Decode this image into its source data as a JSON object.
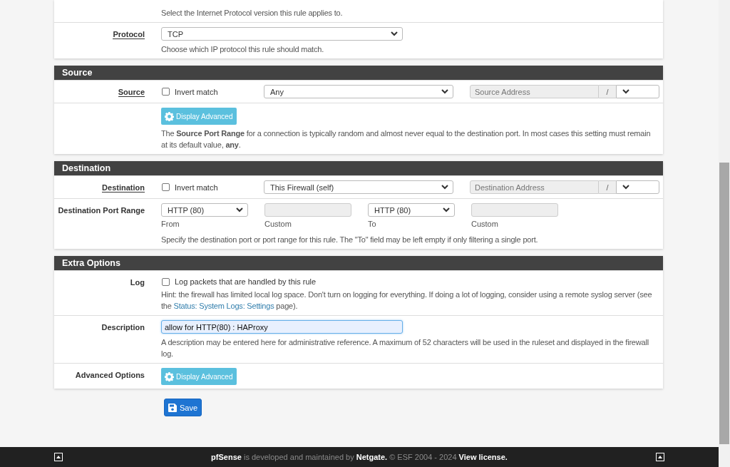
{
  "panels": [
    {
      "rows": [
        {
          "kind": "hint",
          "hint": "Select the Internet Protocol version this rule applies to."
        },
        {
          "kind": "select",
          "label": "Protocol",
          "has_help": true,
          "value": "TCP",
          "hint": "Choose which IP protocol this rule should match."
        }
      ]
    },
    {
      "title": "Source",
      "rows": [
        {
          "kind": "address",
          "label": "Source",
          "has_help": true,
          "invert_label": "Invert match",
          "invert_checked": false,
          "type_value": "Any",
          "address_placeholder": "Source Address",
          "slash": "/"
        },
        {
          "kind": "advanced",
          "button": "Display Advanced",
          "hint": "The **Source Port Range** for a connection is typically random and almost never equal to the destination port. In most cases this setting must remain at its default value, **any**."
        }
      ]
    },
    {
      "title": "Destination",
      "rows": [
        {
          "kind": "address",
          "label": "Destination",
          "has_help": true,
          "invert_label": "Invert match",
          "invert_checked": false,
          "type_value": "This Firewall (self)",
          "address_placeholder": "Destination Address",
          "slash": "/"
        },
        {
          "kind": "port-range",
          "label": "Destination Port Range",
          "has_help": false,
          "from_value": "HTTP (80)",
          "from_caption": "From",
          "from_custom_caption": "Custom",
          "to_value": "HTTP (80)",
          "to_caption": "To",
          "to_custom_caption": "Custom",
          "hint": "Specify the destination port or port range for this rule. The \"To\" field may be left empty if only filtering a single port."
        }
      ]
    },
    {
      "title": "Extra Options",
      "rows": [
        {
          "kind": "checkbox",
          "label": "Log",
          "has_help": false,
          "checked": false,
          "text": "Log packets that are handled by this rule",
          "hint_before": "Hint: the firewall has limited local log space. Don't turn on logging for everything. If doing a lot of logging, consider using a remote syslog server (see the ",
          "hint_link": "Status: System Logs: Settings",
          "hint_after": " page)."
        },
        {
          "kind": "text",
          "label": "Description",
          "has_help": false,
          "value": "allow for HTTP(80) : HAProxy",
          "focused": true,
          "hint": "A description may be entered here for administrative reference. A maximum of 52 characters will be used in the ruleset and displayed in the firewall log."
        },
        {
          "kind": "advanced",
          "label": "Advanced Options",
          "has_help": false,
          "button": "Display Advanced"
        }
      ]
    }
  ],
  "save_button": "Save",
  "footer": {
    "brand": "pfSense",
    "text": " is developed and maintained by ",
    "company": "Netgate.",
    "copyright": " © ESF 2004 - 2024 ",
    "license": "View license."
  }
}
